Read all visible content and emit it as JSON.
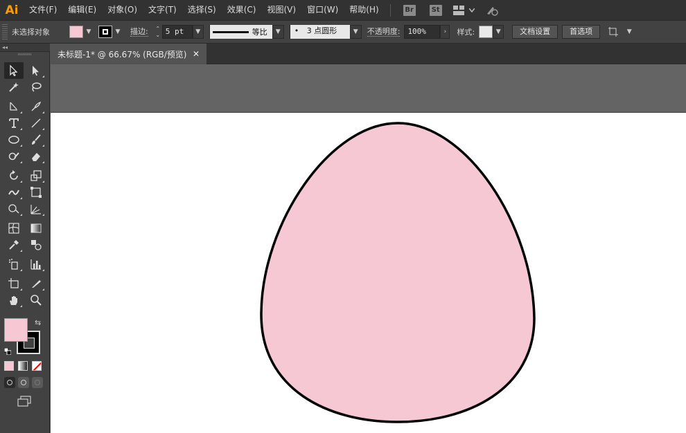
{
  "menubar": {
    "logo": "Ai",
    "items": [
      "文件(F)",
      "编辑(E)",
      "对象(O)",
      "文字(T)",
      "选择(S)",
      "效果(C)",
      "视图(V)",
      "窗口(W)",
      "帮助(H)"
    ],
    "badges": [
      "Br",
      "St"
    ],
    "icons": [
      "workspace-grid-icon",
      "chevron-down-icon",
      "gpu-performance-icon"
    ]
  },
  "controlbar": {
    "selection_label": "未选择对象",
    "fill_color": "#f5c8d4",
    "stroke_color": "#000000",
    "stroke_label": "描边",
    "stroke_value": "5 pt",
    "profile_label": "等比",
    "brush_label": "3 点圆形",
    "brush_dot": "•",
    "opacity_label": "不透明度",
    "opacity_value": "100%",
    "style_label": "样式",
    "doc_setup_button": "文档设置",
    "preferences_button": "首选项"
  },
  "toolbar": {
    "collapse": "◂◂",
    "fill_color": "#f5c8d4",
    "stroke_color": "#000000"
  },
  "document": {
    "tab_title": "未标题-1* @ 66.67% (RGB/预览)",
    "close_glyph": "✕"
  },
  "artwork": {
    "shape": "egg",
    "fill": "#f5c8d4",
    "stroke": "#000000"
  }
}
